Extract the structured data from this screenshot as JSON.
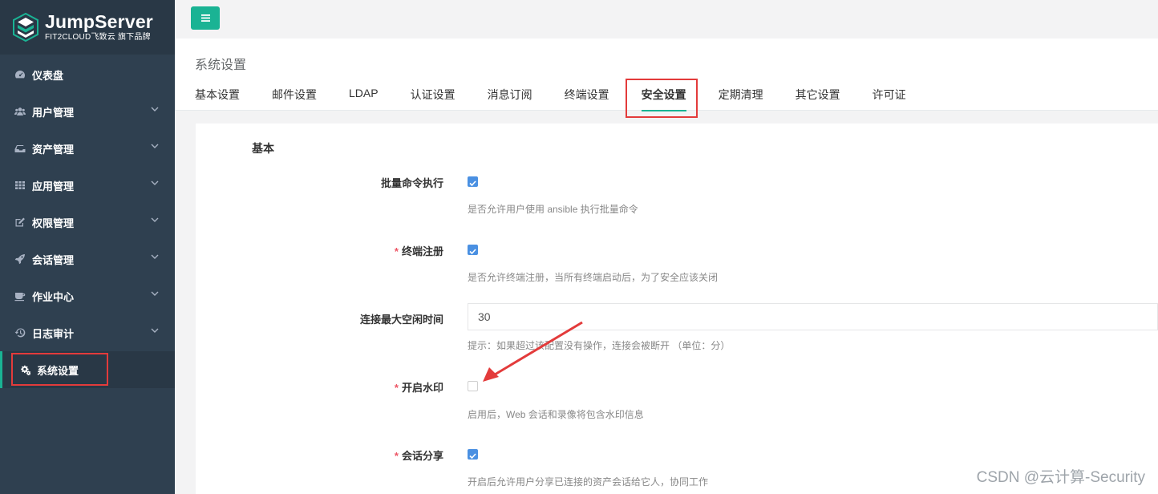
{
  "brand": {
    "title": "JumpServer",
    "subtitle": "FIT2CLOUD飞致云 旗下品牌"
  },
  "sidebar": {
    "items": [
      {
        "label": "仪表盘",
        "icon": "dashboard-icon",
        "expandable": false
      },
      {
        "label": "用户管理",
        "icon": "users-icon",
        "expandable": true
      },
      {
        "label": "资产管理",
        "icon": "inbox-icon",
        "expandable": true
      },
      {
        "label": "应用管理",
        "icon": "grid-icon",
        "expandable": true
      },
      {
        "label": "权限管理",
        "icon": "edit-icon",
        "expandable": true
      },
      {
        "label": "会话管理",
        "icon": "rocket-icon",
        "expandable": true
      },
      {
        "label": "作业中心",
        "icon": "coffee-icon",
        "expandable": true
      },
      {
        "label": "日志审计",
        "icon": "history-icon",
        "expandable": true
      },
      {
        "label": "系统设置",
        "icon": "gears-icon",
        "expandable": false,
        "active": true
      }
    ]
  },
  "header": {
    "title": "系统设置",
    "tabs": [
      {
        "label": "基本设置"
      },
      {
        "label": "邮件设置"
      },
      {
        "label": "LDAP"
      },
      {
        "label": "认证设置"
      },
      {
        "label": "消息订阅"
      },
      {
        "label": "终端设置"
      },
      {
        "label": "安全设置",
        "active": true
      },
      {
        "label": "定期清理"
      },
      {
        "label": "其它设置"
      },
      {
        "label": "许可证"
      }
    ]
  },
  "form": {
    "section": "基本",
    "fields": {
      "batch_command": {
        "label": "批量命令执行",
        "required": false,
        "checked": true,
        "help": "是否允许用户使用 ansible 执行批量命令"
      },
      "terminal_register": {
        "label": "终端注册",
        "required": true,
        "checked": true,
        "help": "是否允许终端注册，当所有终端启动后，为了安全应该关闭"
      },
      "max_idle": {
        "label": "连接最大空闲时间",
        "required": false,
        "value": "30",
        "help": "提示：如果超过该配置没有操作，连接会被断开 （单位：分）"
      },
      "watermark": {
        "label": "开启水印",
        "required": true,
        "checked": false,
        "help": "启用后，Web 会话和录像将包含水印信息"
      },
      "session_share": {
        "label": "会话分享",
        "required": true,
        "checked": true,
        "help": "开启后允许用户分享已连接的资产会话给它人，协同工作"
      }
    },
    "required_mark": "*"
  },
  "colors": {
    "sidebar_bg": "#2f4050",
    "accent": "#1ab394",
    "checkbox": "#4a90e2",
    "highlight": "#e33b3b"
  },
  "watermark_text": "CSDN @云计算-Security"
}
